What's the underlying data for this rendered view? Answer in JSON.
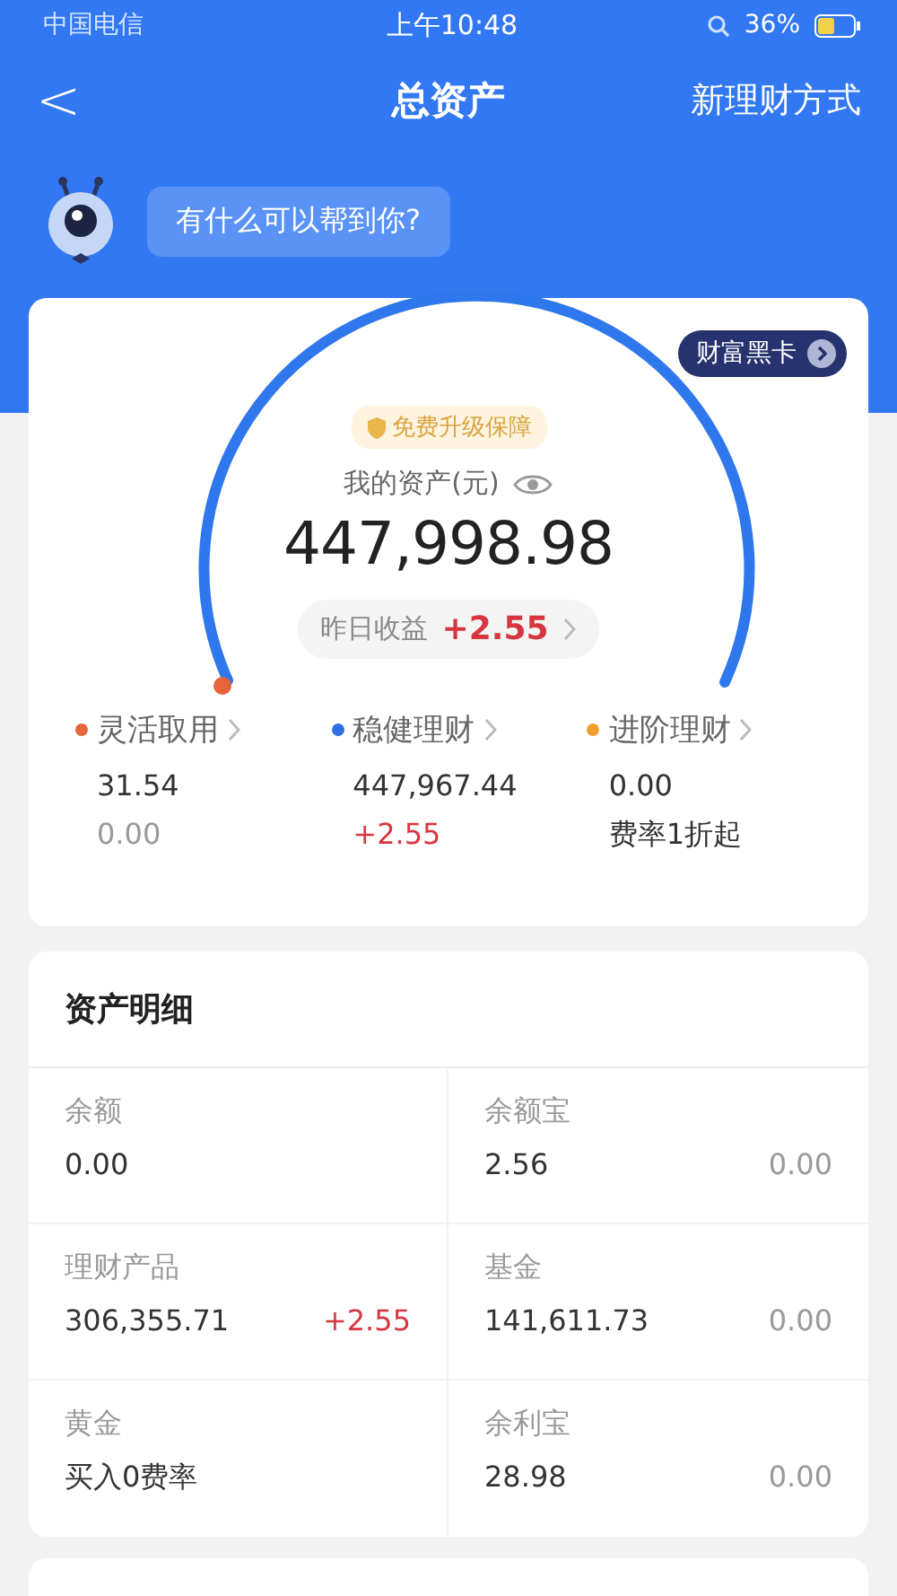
{
  "status_bar": {
    "carrier": "中国电信",
    "time": "上午10:48",
    "battery": "36%"
  },
  "nav": {
    "back": "<",
    "title": "总资产",
    "action": "新理财方式"
  },
  "assistant": {
    "message": "有什么可以帮到你?"
  },
  "summary": {
    "badge": "财富黑卡",
    "upgrade": "免费升级保障",
    "label": "我的资产(元)",
    "total": "447,998.98",
    "yesterday_label": "昨日收益",
    "yesterday_value": "+2.55",
    "categories": [
      {
        "name": "灵活取用",
        "color": "#e8643a",
        "value": "31.54",
        "sub": "0.00",
        "kind": "muted"
      },
      {
        "name": "稳健理财",
        "color": "#2f6fe6",
        "value": "447,967.44",
        "sub": "+2.55",
        "kind": "gain"
      },
      {
        "name": "进阶理财",
        "color": "#f0a030",
        "value": "0.00",
        "sub": "费率1折起",
        "kind": "note"
      }
    ]
  },
  "details": {
    "title": "资产明细",
    "items": [
      {
        "name": "余额",
        "value": "0.00"
      },
      {
        "name": "余额宝",
        "value": "2.56",
        "change": "0.00",
        "kind": "muted"
      },
      {
        "name": "理财产品",
        "value": "306,355.71",
        "change": "+2.55",
        "kind": "gain"
      },
      {
        "name": "基金",
        "value": "141,611.73",
        "change": "0.00",
        "kind": "muted"
      },
      {
        "name": "黄金",
        "value": "买入0费率"
      },
      {
        "name": "余利宝",
        "value": "28.98",
        "change": "0.00",
        "kind": "muted"
      }
    ]
  }
}
